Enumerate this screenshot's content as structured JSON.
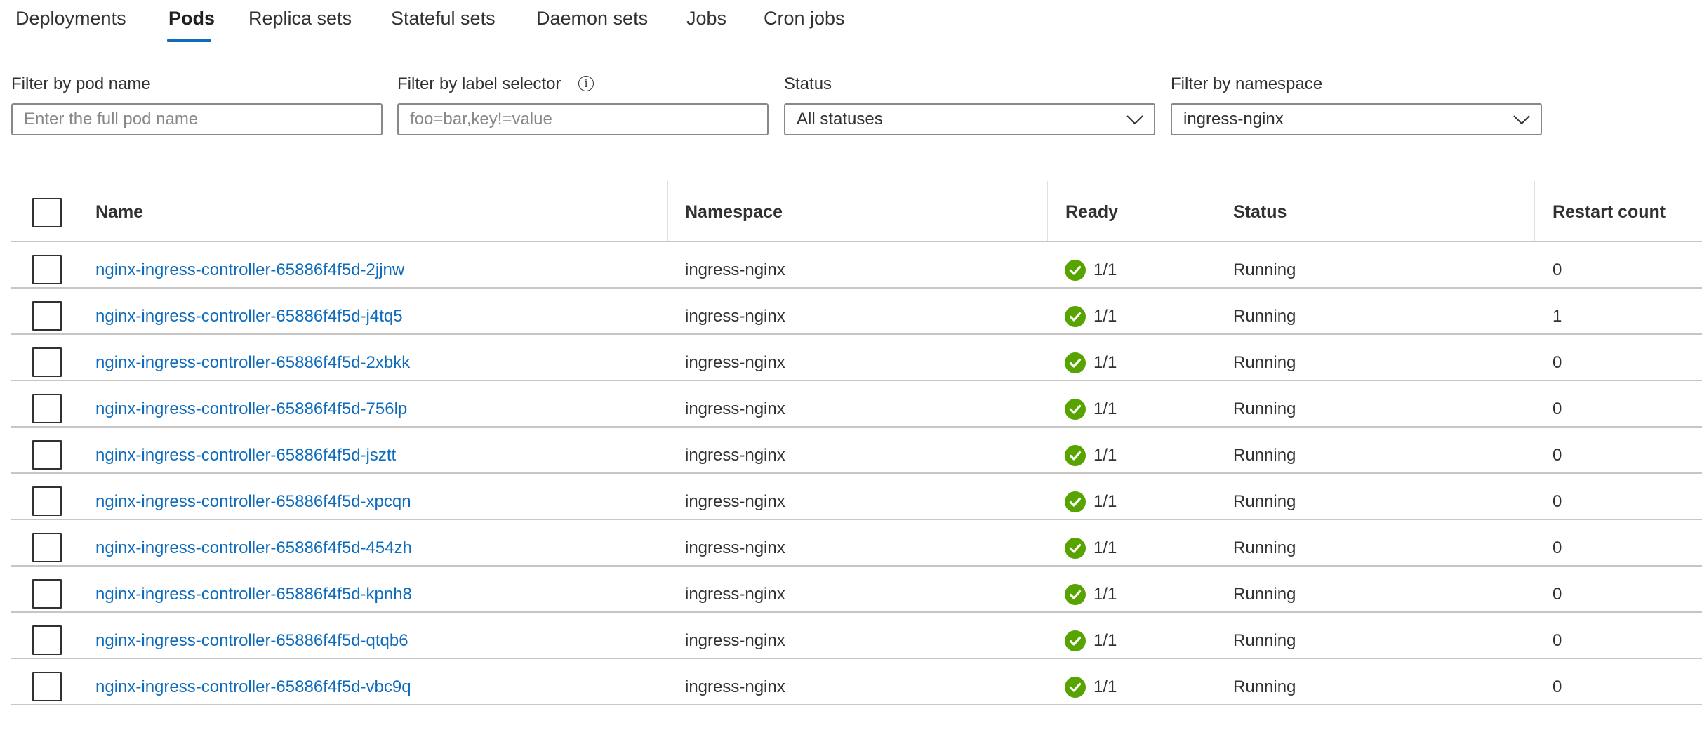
{
  "tabs": [
    {
      "label": "Deployments",
      "active": false
    },
    {
      "label": "Pods",
      "active": true
    },
    {
      "label": "Replica sets",
      "active": false
    },
    {
      "label": "Stateful sets",
      "active": false
    },
    {
      "label": "Daemon sets",
      "active": false
    },
    {
      "label": "Jobs",
      "active": false
    },
    {
      "label": "Cron jobs",
      "active": false
    }
  ],
  "filters": {
    "pod_name": {
      "label": "Filter by pod name",
      "placeholder": "Enter the full pod name",
      "value": ""
    },
    "label_selector": {
      "label": "Filter by label selector",
      "placeholder": "foo=bar,key!=value",
      "value": "",
      "info_icon": "info-icon"
    },
    "status": {
      "label": "Status",
      "value": "All statuses"
    },
    "namespace": {
      "label": "Filter by namespace",
      "value": "ingress-nginx"
    }
  },
  "table": {
    "columns": [
      "Name",
      "Namespace",
      "Ready",
      "Status",
      "Restart count"
    ],
    "rows": [
      {
        "name": "nginx-ingress-controller-65886f4f5d-2jjnw",
        "namespace": "ingress-nginx",
        "ready": "1/1",
        "status": "Running",
        "restarts": "0"
      },
      {
        "name": "nginx-ingress-controller-65886f4f5d-j4tq5",
        "namespace": "ingress-nginx",
        "ready": "1/1",
        "status": "Running",
        "restarts": "1"
      },
      {
        "name": "nginx-ingress-controller-65886f4f5d-2xbkk",
        "namespace": "ingress-nginx",
        "ready": "1/1",
        "status": "Running",
        "restarts": "0"
      },
      {
        "name": "nginx-ingress-controller-65886f4f5d-756lp",
        "namespace": "ingress-nginx",
        "ready": "1/1",
        "status": "Running",
        "restarts": "0"
      },
      {
        "name": "nginx-ingress-controller-65886f4f5d-jsztt",
        "namespace": "ingress-nginx",
        "ready": "1/1",
        "status": "Running",
        "restarts": "0"
      },
      {
        "name": "nginx-ingress-controller-65886f4f5d-xpcqn",
        "namespace": "ingress-nginx",
        "ready": "1/1",
        "status": "Running",
        "restarts": "0"
      },
      {
        "name": "nginx-ingress-controller-65886f4f5d-454zh",
        "namespace": "ingress-nginx",
        "ready": "1/1",
        "status": "Running",
        "restarts": "0"
      },
      {
        "name": "nginx-ingress-controller-65886f4f5d-kpnh8",
        "namespace": "ingress-nginx",
        "ready": "1/1",
        "status": "Running",
        "restarts": "0"
      },
      {
        "name": "nginx-ingress-controller-65886f4f5d-qtqb6",
        "namespace": "ingress-nginx",
        "ready": "1/1",
        "status": "Running",
        "restarts": "0"
      },
      {
        "name": "nginx-ingress-controller-65886f4f5d-vbc9q",
        "namespace": "ingress-nginx",
        "ready": "1/1",
        "status": "Running",
        "restarts": "0"
      }
    ]
  },
  "colors": {
    "accent": "#0f6cbd",
    "link": "#0f6cbd",
    "ready_ok": "#57a300",
    "text": "#323130",
    "divider": "#c8c6c4"
  }
}
